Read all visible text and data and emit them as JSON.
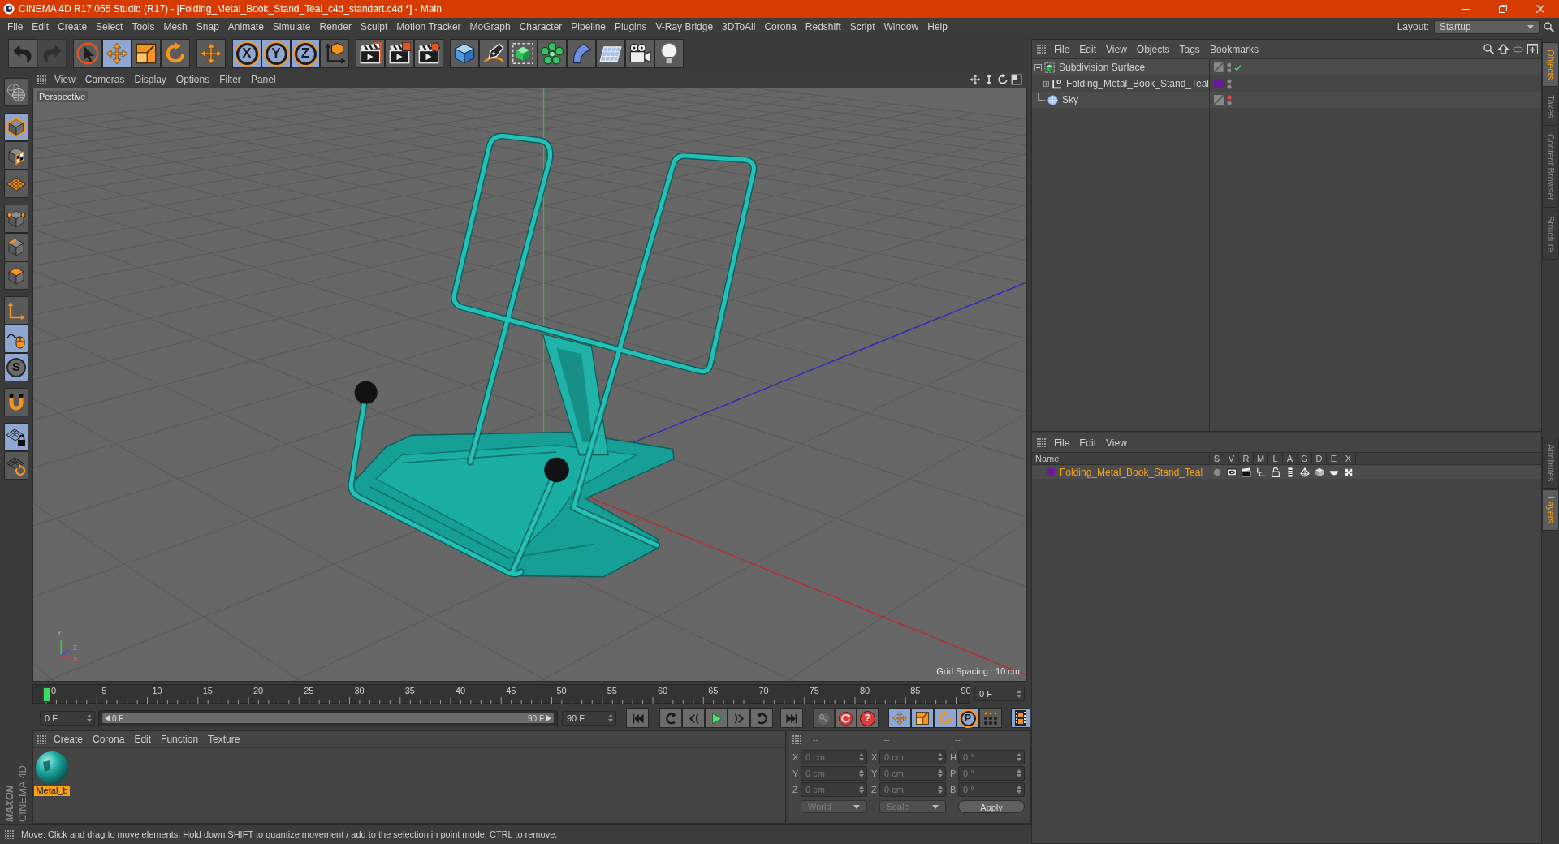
{
  "window": {
    "title": "CINEMA 4D R17.055 Studio (R17) - [Folding_Metal_Book_Stand_Teal_c4d_standart.c4d *] - Main"
  },
  "menu_bar": {
    "items": [
      "File",
      "Edit",
      "Create",
      "Select",
      "Tools",
      "Mesh",
      "Snap",
      "Animate",
      "Simulate",
      "Render",
      "Sculpt",
      "Motion Tracker",
      "MoGraph",
      "Character",
      "Pipeline",
      "Plugins",
      "V-Ray Bridge",
      "3DToAll",
      "Corona",
      "Redshift",
      "Script",
      "Window",
      "Help"
    ],
    "layout_label": "Layout:",
    "layout_value": "Startup"
  },
  "toolbar": {
    "groups": [
      [
        {
          "kind": "undo",
          "selected": false,
          "disabled": false
        },
        {
          "kind": "redo",
          "selected": false,
          "disabled": true
        }
      ],
      [
        {
          "kind": "select",
          "selected": false,
          "disabled": false
        },
        {
          "kind": "move",
          "selected": true,
          "disabled": false
        },
        {
          "kind": "scale",
          "selected": false,
          "disabled": false
        },
        {
          "kind": "rotate",
          "selected": false,
          "disabled": false
        }
      ],
      [
        {
          "kind": "move",
          "selected": false,
          "disabled": false
        }
      ],
      [
        {
          "kind": "axis",
          "label": "X",
          "selected": true,
          "disabled": false
        },
        {
          "kind": "axis",
          "label": "Y",
          "selected": true,
          "disabled": false
        },
        {
          "kind": "axis",
          "label": "Z",
          "selected": true,
          "disabled": false
        },
        {
          "kind": "coordinate_system",
          "selected": false,
          "disabled": false
        }
      ],
      [
        {
          "kind": "render_view",
          "selected": false,
          "disabled": false
        },
        {
          "kind": "render_picture_viewer",
          "selected": false,
          "disabled": false
        },
        {
          "kind": "render_settings",
          "selected": false,
          "disabled": false
        }
      ],
      [
        {
          "kind": "cube",
          "selected": false,
          "disabled": false
        },
        {
          "kind": "pen",
          "selected": false,
          "disabled": false
        },
        {
          "kind": "subdivision",
          "selected": false,
          "disabled": false
        },
        {
          "kind": "cloner",
          "selected": false,
          "disabled": false
        },
        {
          "kind": "deformer",
          "selected": false,
          "disabled": false
        },
        {
          "kind": "floor",
          "selected": false,
          "disabled": false
        },
        {
          "kind": "camera",
          "selected": false,
          "disabled": false
        },
        {
          "kind": "light",
          "selected": false,
          "disabled": false
        }
      ]
    ]
  },
  "tool_palette": {
    "groups": [
      [
        {
          "kind": "make_editable",
          "selected": false
        }
      ],
      [
        {
          "kind": "model",
          "selected": true
        },
        {
          "kind": "texture",
          "selected": false
        },
        {
          "kind": "workplane",
          "selected": false
        }
      ],
      [
        {
          "kind": "points",
          "selected": false
        },
        {
          "kind": "edges",
          "selected": false
        },
        {
          "kind": "polygons",
          "selected": false
        }
      ],
      [
        {
          "kind": "axis",
          "selected": false
        },
        {
          "kind": "tweak",
          "selected": true
        },
        {
          "kind": "snap",
          "label": "S",
          "selected": true
        }
      ],
      [
        {
          "kind": "magnet",
          "selected": false
        }
      ],
      [
        {
          "kind": "workplane_lock",
          "selected": true
        },
        {
          "kind": "workplane_rotate",
          "selected": false
        }
      ]
    ]
  },
  "logo": {
    "brand": "MAXON",
    "product": "CINEMA 4D"
  },
  "viewport": {
    "menu": [
      "View",
      "Cameras",
      "Display",
      "Options",
      "Filter",
      "Panel"
    ],
    "camera": "Perspective",
    "grid_spacing": "Grid Spacing : 10 cm",
    "axis_labels": [
      "Y",
      "Z",
      "X"
    ]
  },
  "timeline": {
    "ticks": [
      "0",
      "5",
      "10",
      "15",
      "20",
      "25",
      "30",
      "35",
      "40",
      "45",
      "50",
      "55",
      "60",
      "65",
      "70",
      "75",
      "80",
      "85",
      "90"
    ],
    "playhead": {
      "level": 0
    },
    "current_frame": "0 F"
  },
  "playback": {
    "start_frame": "0 F",
    "range": {
      "start": "0 F",
      "end": "90 F",
      "level": 1
    },
    "end_frame": "90 F",
    "transport": [
      [
        {
          "kind": "go_start"
        }
      ],
      [
        {
          "kind": "prev_key"
        },
        {
          "kind": "prev_frame"
        },
        {
          "kind": "play"
        },
        {
          "kind": "next_frame"
        },
        {
          "kind": "next_key"
        }
      ],
      [
        {
          "kind": "go_end"
        }
      ]
    ],
    "record": [
      {
        "kind": "record_objects",
        "disabled": true
      },
      {
        "kind": "autokey",
        "disabled": false
      },
      {
        "kind": "keyframe_selection",
        "label": "?",
        "disabled": false
      }
    ],
    "key_filters": [
      {
        "kind": "move",
        "selected": true
      },
      {
        "kind": "scale",
        "selected": true
      },
      {
        "kind": "rotate",
        "selected": true
      },
      {
        "kind": "parameter",
        "label": "P",
        "selected": true
      },
      {
        "kind": "points",
        "selected": false
      }
    ],
    "timeline_button": {
      "selected": true
    }
  },
  "material_manager": {
    "menu": [
      "Create",
      "Corona",
      "Edit",
      "Function",
      "Texture"
    ],
    "materials": [
      {
        "name": "Metal_b",
        "selected": true
      }
    ]
  },
  "coordinates": {
    "headers": [
      "--",
      "--",
      "--"
    ],
    "rows": [
      [
        {
          "axis": "X",
          "value": "0 cm"
        },
        {
          "axis": "X",
          "value": "0 cm"
        },
        {
          "axis": "H",
          "value": "0 °"
        }
      ],
      [
        {
          "axis": "Y",
          "value": "0 cm"
        },
        {
          "axis": "Y",
          "value": "0 cm"
        },
        {
          "axis": "P",
          "value": "0 °"
        }
      ],
      [
        {
          "axis": "Z",
          "value": "0 cm"
        },
        {
          "axis": "Z",
          "value": "0 cm"
        },
        {
          "axis": "B",
          "value": "0 °"
        }
      ]
    ],
    "dropdowns": [
      "World",
      "Scale"
    ],
    "apply": "Apply"
  },
  "status_bar": {
    "text": "Move: Click and drag to move elements. Hold down SHIFT to quantize movement / add to the selection in point mode, CTRL to remove."
  },
  "object_manager": {
    "menu": [
      "File",
      "Edit",
      "View",
      "Objects",
      "Tags",
      "Bookmarks"
    ],
    "objects": [
      {
        "name": "Subdivision Surface",
        "kind": "subdivision",
        "expanded": true,
        "enabled": true,
        "visible_in_editor": true,
        "selected": false,
        "children": [
          {
            "name": "Folding_Metal_Book_Stand_Teal",
            "kind": "null",
            "expanded": false,
            "color": "#6a1b9a",
            "visible_in_editor": true,
            "selected": false
          }
        ]
      },
      {
        "name": "Sky",
        "kind": "sky",
        "visible_in_editor": false,
        "selected": false
      }
    ]
  },
  "layer_manager": {
    "menu": [
      "File",
      "Edit",
      "View"
    ],
    "columns": [
      "Name",
      "S",
      "V",
      "R",
      "M",
      "L",
      "A",
      "G",
      "D",
      "E",
      "X"
    ],
    "layers": [
      {
        "name": "Folding_Metal_Book_Stand_Teal",
        "color": "#6a1b9a",
        "selected": true
      }
    ]
  },
  "side_tabs": {
    "upper": [
      {
        "label": "Objects",
        "selected": true
      },
      {
        "label": "Takes",
        "selected": false
      },
      {
        "label": "Content Browser",
        "selected": false
      },
      {
        "label": "Structure",
        "selected": false
      }
    ],
    "lower": [
      {
        "label": "Attributes",
        "selected": false
      },
      {
        "label": "Layers",
        "selected": true
      }
    ]
  }
}
